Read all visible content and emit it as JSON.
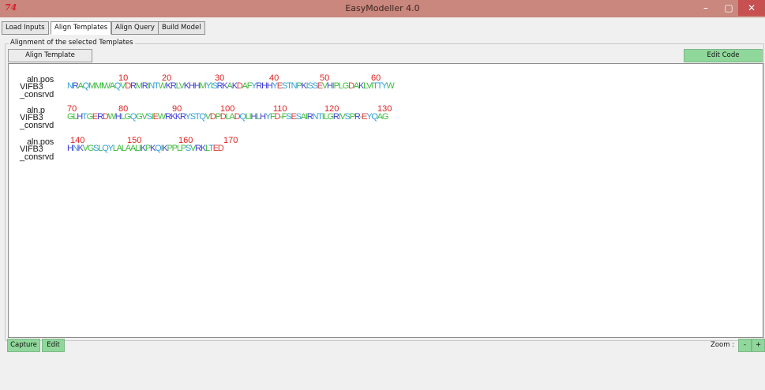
{
  "window": {
    "title": "EasyModeller 4.0",
    "app_icon_text": "74",
    "controls": {
      "minimize": "–",
      "maximize": "▢",
      "close": "✕"
    }
  },
  "tabs": [
    {
      "label": "Load Inputs",
      "active": false
    },
    {
      "label": "Align Templates",
      "active": true
    },
    {
      "label": "Align Query",
      "active": false
    },
    {
      "label": "Build Model",
      "active": false
    }
  ],
  "group": {
    "title": "Alignment of the selected Templates"
  },
  "buttons": {
    "align_template": "Align Template",
    "edit_code": "Edit Code",
    "capture": "Capture",
    "edit": "Edit",
    "zoom_label": "Zoom :",
    "zoom_minus": "-",
    "zoom_plus": "+"
  },
  "colors": {
    "titlebar": "#c9877d",
    "green_button": "#90d79b",
    "position_numbers": "#e02020"
  },
  "alignment": {
    "blocks": [
      {
        "row_labels": [
          "aln.pos",
          "VIFB3",
          "_consrvd"
        ],
        "position_numbers": [
          "10",
          "20",
          "30",
          "40",
          "50",
          "60"
        ],
        "sequence": "NRAQMMIWAQVDRMRINTWKRLVKHHMYISRKAKDAFYRHHYESTNPKISSEVHIPLGDAKLVITTYW"
      },
      {
        "row_labels": [
          "aln.p",
          "VIFB3",
          "_consrvd"
        ],
        "position_numbers": [
          "70",
          "80",
          "90",
          "100",
          "110",
          "120",
          "130"
        ],
        "sequence": "GLHTGERDWHLGQGVSIEWRKKRYSTQVDPDLADQLIHLHYFD-FSESAIRNTILGRIVSPR-EYQAG"
      },
      {
        "row_labels": [
          "aln.pos",
          "VIFB3",
          "_consrvd"
        ],
        "position_numbers": [
          "140",
          "150",
          "160",
          "170"
        ],
        "sequence": "HNKVGSLQYLALAALIKPKQIKPPLPSVRKLTED"
      }
    ]
  }
}
